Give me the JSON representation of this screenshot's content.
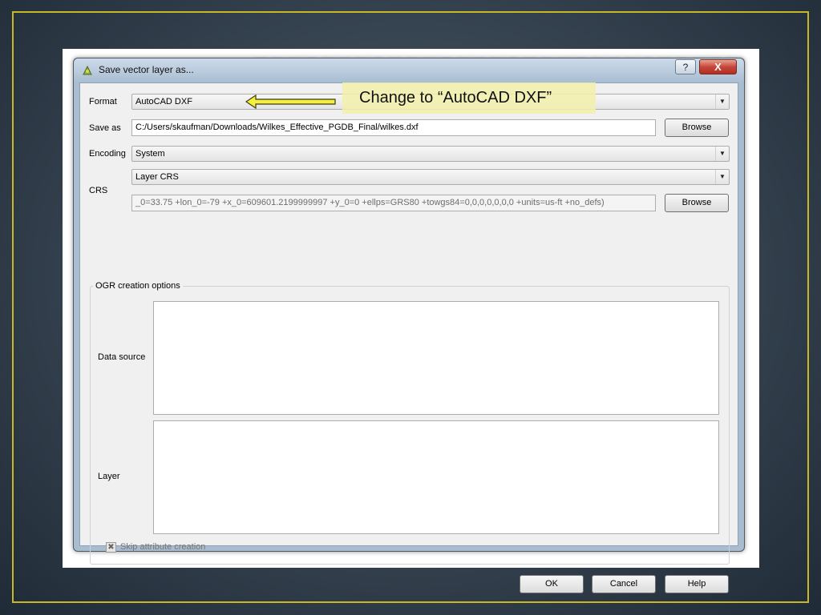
{
  "dialog": {
    "title": "Save vector layer as...",
    "help_label": "?",
    "close_label": "X"
  },
  "form": {
    "format_label": "Format",
    "format_value": "AutoCAD DXF",
    "saveas_label": "Save as",
    "saveas_value": "C:/Users/skaufman/Downloads/Wilkes_Effective_PGDB_Final/wilkes.dxf",
    "browse_label": "Browse",
    "encoding_label": "Encoding",
    "encoding_value": "System",
    "crs_label": "CRS",
    "crs_value": "Layer CRS",
    "crs_proj_value": "_0=33.75 +lon_0=-79 +x_0=609601.2199999997 +y_0=0 +ellps=GRS80 +towgs84=0,0,0,0,0,0,0 +units=us-ft +no_defs)",
    "crs_browse_label": "Browse",
    "ogr_group_label": "OGR creation options",
    "datasource_label": "Data source",
    "layer_label": "Layer",
    "skip_attr_label": "Skip attribute creation",
    "skip_attr_checked": true
  },
  "buttons": {
    "ok": "OK",
    "cancel": "Cancel",
    "help": "Help"
  },
  "annotation": {
    "callout_text": "Change to “AutoCAD DXF”",
    "arrow_color": "#f5f03c",
    "highlight_color": "#f3f0aa"
  },
  "theme": {
    "frame_color": "#c9b826",
    "close_button_color": "#c4473a"
  }
}
